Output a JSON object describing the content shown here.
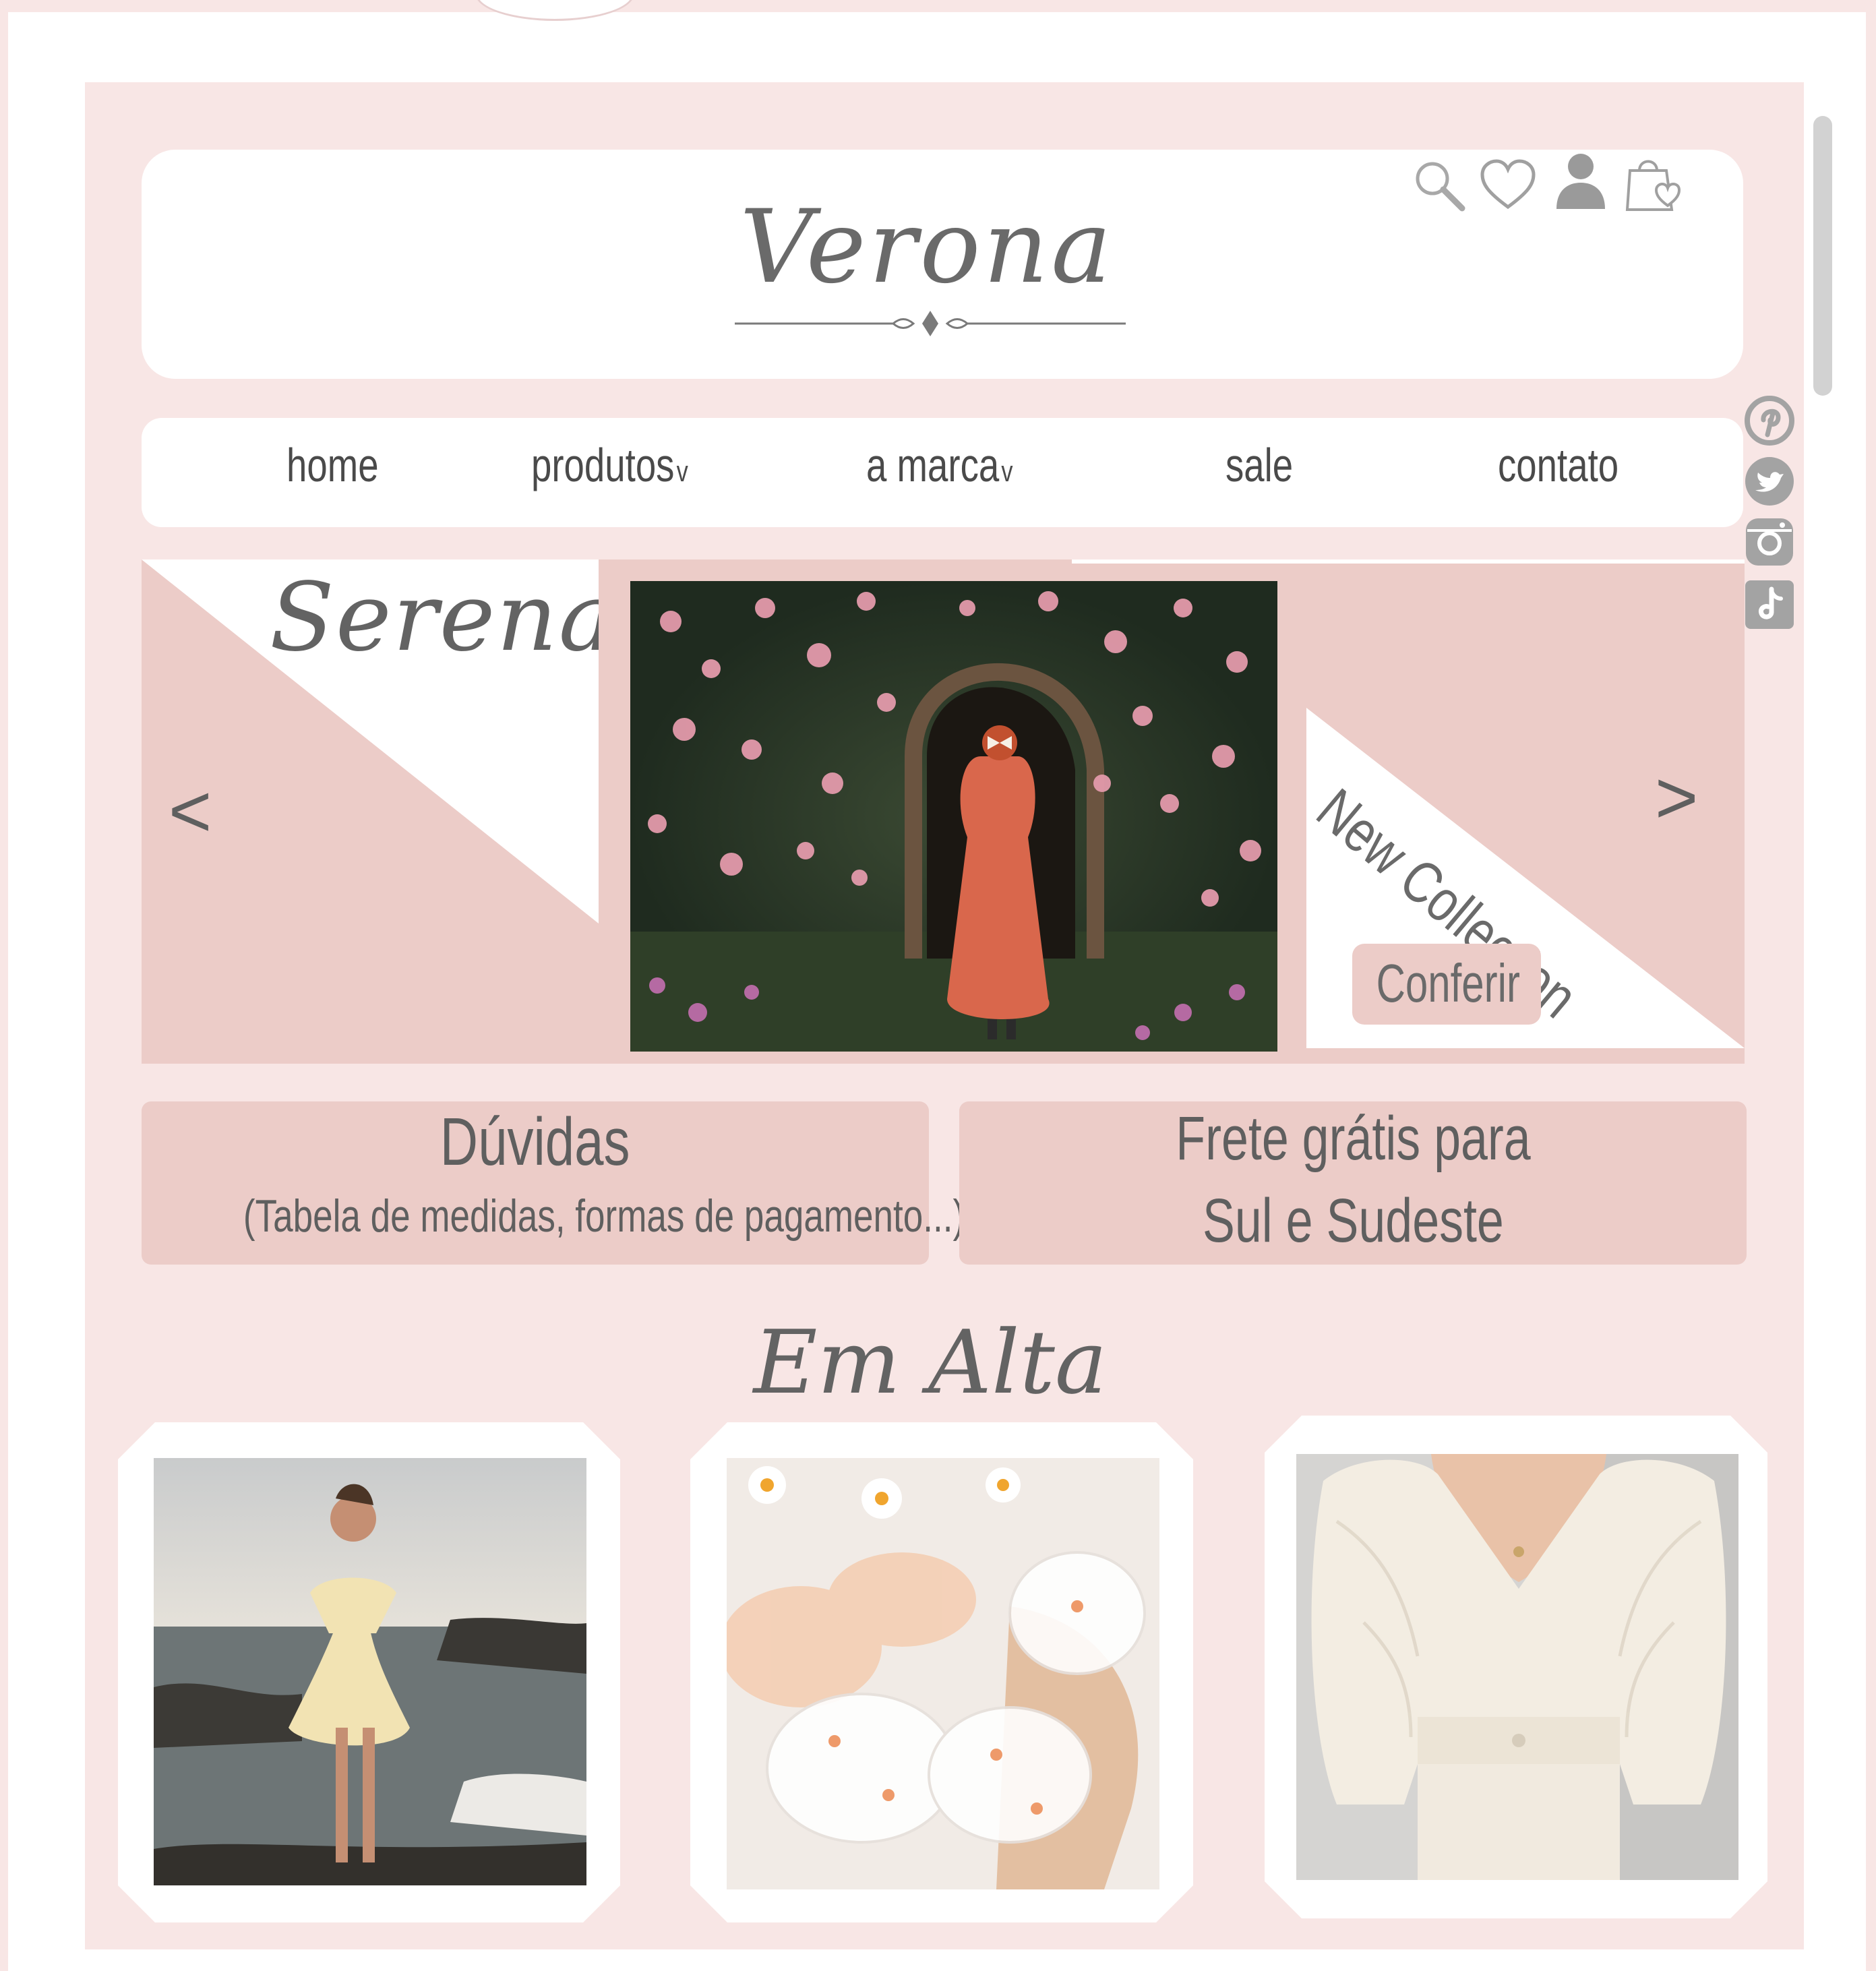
{
  "brand": {
    "name": "Verona"
  },
  "nav": {
    "items": [
      {
        "label": "home",
        "caret": ""
      },
      {
        "label": "produtos",
        "caret": "v"
      },
      {
        "label": "a marca",
        "caret": "v"
      },
      {
        "label": "sale",
        "caret": ""
      },
      {
        "label": "contato",
        "caret": ""
      }
    ]
  },
  "header_icons": [
    "search-icon",
    "heart-icon",
    "user-icon",
    "shopping-bag-icon"
  ],
  "social_icons": [
    "pinterest-icon",
    "twitter-icon",
    "instagram-icon",
    "tiktok-icon"
  ],
  "banner": {
    "title": "Serena",
    "tagline": "New Collection",
    "cta_label": "Conferir",
    "prev_label": "<",
    "next_label": ">"
  },
  "info": {
    "faq_title": "Dúvidas",
    "faq_subtitle": "(Tabela de medidas, formas de pagamento...)",
    "shipping_line1": "Frete grátis para",
    "shipping_line2": "Sul e Sudeste"
  },
  "trending": {
    "title": "Em Alta"
  },
  "colors": {
    "page_bg": "#f8e6e5",
    "accent_pink": "#ecccc8",
    "text_gray": "#5f5f5f",
    "icon_gray": "#9a9a9a"
  }
}
